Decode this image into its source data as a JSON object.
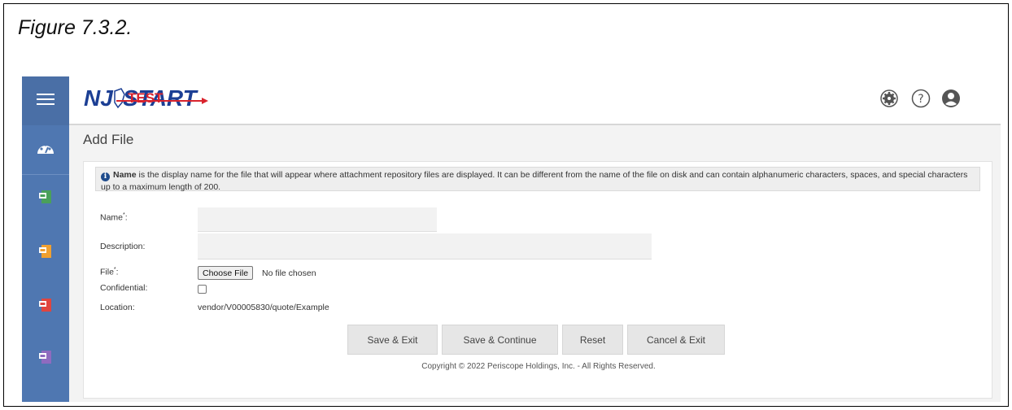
{
  "figure_caption": "Figure 7.3.2.",
  "logo": {
    "text_main": "NJ",
    "text_start": "START",
    "text_overlay": "TEST"
  },
  "header_icons": [
    "gear-icon",
    "help-icon",
    "user-icon"
  ],
  "sidebar_icons": [
    "menu-icon",
    "dashboard-icon",
    "green-document-icon",
    "orange-document-icon",
    "red-document-icon",
    "purple-document-icon"
  ],
  "page_title": "Add File",
  "info": {
    "bold": "Name",
    "text": " is the display name for the file that will appear where attachment repository files are displayed. It can be different from the name of the file on disk and can contain alphanumeric characters, spaces, and special characters up to a maximum length of 200."
  },
  "form": {
    "name_label": "Name",
    "name_required": "*",
    "name_suffix": ":",
    "name_value": "",
    "description_label": "Description:",
    "description_value": "",
    "file_label": "File",
    "file_required": "*",
    "file_suffix": ":",
    "file_button": "Choose File",
    "file_status": "No file chosen",
    "confidential_label": "Confidential:",
    "confidential_checked": false,
    "location_label": "Location:",
    "location_value": "vendor/V00005830/quote/Example"
  },
  "buttons": {
    "save_exit": "Save & Exit",
    "save_continue": "Save & Continue",
    "reset": "Reset",
    "cancel_exit": "Cancel & Exit"
  },
  "footer": {
    "copyright": "Copyright © 2022 Periscope Holdings, Inc. - All Rights Reserved."
  },
  "colors": {
    "sidebar": "#4f77b1",
    "logo_blue": "#1c3f94",
    "logo_red": "#d9232d"
  }
}
